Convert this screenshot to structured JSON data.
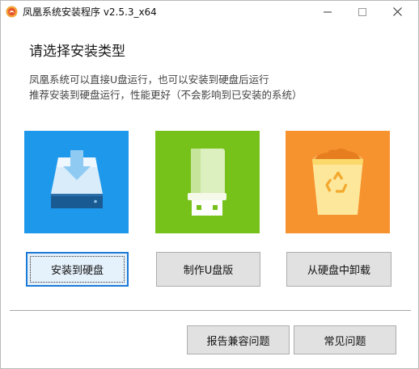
{
  "window": {
    "title": "凤凰系统安装程序 v2.5.3_x64",
    "icon": "phoenix-app-icon",
    "controls": {
      "minimize": "minimize-icon",
      "maximize": "maximize-icon",
      "close": "close-icon"
    }
  },
  "main": {
    "heading": "请选择安装类型",
    "description_line1": "凤凰系统可以直接U盘运行，也可以安装到硬盘后运行",
    "description_line2": "推荐安装到硬盘运行，性能更好（不会影响到已安装的系统）"
  },
  "options": [
    {
      "icon": "hard-disk-download-icon",
      "tile_color": "#1e98ea",
      "button_label": "安装到硬盘"
    },
    {
      "icon": "usb-drive-icon",
      "tile_color": "#76c21a",
      "button_label": "制作U盘版"
    },
    {
      "icon": "recycle-bin-icon",
      "tile_color": "#f7932f",
      "button_label": "从硬盘中卸载"
    }
  ],
  "footer": {
    "report_label": "报告兼容问题",
    "faq_label": "常见问题"
  },
  "colors": {
    "focus_border": "#1b7ad6",
    "button_bg": "#e1e1e1"
  }
}
